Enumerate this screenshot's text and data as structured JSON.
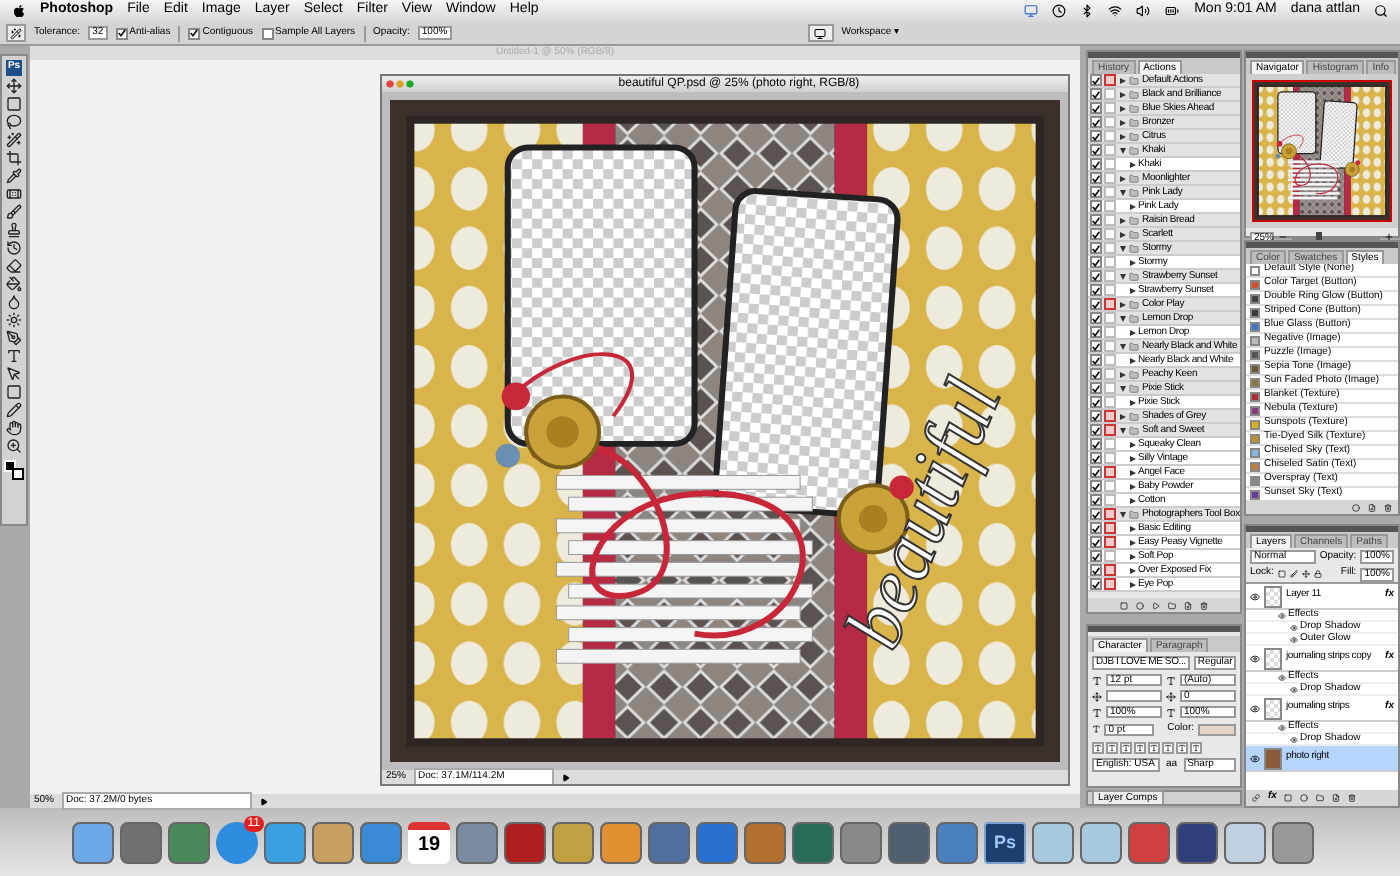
{
  "menu_bar": {
    "app": "Photoshop",
    "menus": [
      "File",
      "Edit",
      "Image",
      "Layer",
      "Select",
      "Filter",
      "View",
      "Window",
      "Help"
    ],
    "clock": "Mon 9:01 AM",
    "user": "dana attlan"
  },
  "options_bar": {
    "tolerance_label": "Tolerance:",
    "tolerance": "32",
    "anti_alias": {
      "label": "Anti-alias",
      "checked": true
    },
    "contiguous": {
      "label": "Contiguous",
      "checked": true
    },
    "sample_all_layers": {
      "label": "Sample All Layers",
      "checked": false
    },
    "opacity_label": "Opacity:",
    "opacity": "100%",
    "workspace": "Workspace ▾"
  },
  "background_window": {
    "title": "Untitled-1 @ 50% (RGB/8)",
    "zoom": "50%",
    "doc_info": "Doc: 37.2M/0 bytes"
  },
  "toolbox": {
    "logo": "Ps"
  },
  "document": {
    "title": "beautiful QP.psd @ 25% (photo right, RGB/8)",
    "word_art": "beautiful",
    "zoom": "25%",
    "doc_info": "Doc: 37.1M/114.2M"
  },
  "actions_panel": {
    "tabs": [
      {
        "label": "History",
        "selected": false
      },
      {
        "label": "Actions",
        "selected": true
      }
    ],
    "items": [
      {
        "name": "Default Actions",
        "checked": true,
        "dialog": true,
        "expanded": false
      },
      {
        "name": "Black and Brilliance",
        "checked": true,
        "dialog": false,
        "expanded": false
      },
      {
        "name": "Blue Skies Ahead",
        "checked": true,
        "dialog": false,
        "expanded": false
      },
      {
        "name": "Bronzer",
        "checked": true,
        "dialog": false,
        "expanded": false
      },
      {
        "name": "Citrus",
        "checked": true,
        "dialog": false,
        "expanded": false
      },
      {
        "name": "Khaki",
        "checked": true,
        "dialog": false,
        "expanded": true,
        "children": [
          {
            "name": "Khaki",
            "checked": true,
            "dialog": false
          }
        ]
      },
      {
        "name": "Moonlighter",
        "checked": true,
        "dialog": false,
        "expanded": false
      },
      {
        "name": "Pink Lady",
        "checked": true,
        "dialog": false,
        "expanded": true,
        "children": [
          {
            "name": "Pink Lady",
            "checked": true,
            "dialog": false
          }
        ]
      },
      {
        "name": "Raisin Bread",
        "checked": true,
        "dialog": false,
        "expanded": false
      },
      {
        "name": "Scarlett",
        "checked": true,
        "dialog": false,
        "expanded": false
      },
      {
        "name": "Stormy",
        "checked": true,
        "dialog": false,
        "expanded": true,
        "children": [
          {
            "name": "Stormy",
            "checked": true,
            "dialog": false
          }
        ]
      },
      {
        "name": "Strawberry Sunset",
        "checked": true,
        "dialog": false,
        "expanded": true,
        "children": [
          {
            "name": "Strawberry Sunset",
            "checked": true,
            "dialog": false
          }
        ]
      },
      {
        "name": "Color Play",
        "checked": true,
        "dialog": true,
        "expanded": false
      },
      {
        "name": "Lemon Drop",
        "checked": true,
        "dialog": false,
        "expanded": true,
        "children": [
          {
            "name": "Lemon Drop",
            "checked": true,
            "dialog": false
          }
        ]
      },
      {
        "name": "Nearly Black and White",
        "checked": true,
        "dialog": false,
        "expanded": true,
        "children": [
          {
            "name": "Nearly Black and White",
            "checked": true,
            "dialog": false
          }
        ]
      },
      {
        "name": "Peachy Keen",
        "checked": true,
        "dialog": false,
        "expanded": false
      },
      {
        "name": "Pixie Stick",
        "checked": true,
        "dialog": false,
        "expanded": true,
        "children": [
          {
            "name": "Pixie Stick",
            "checked": true,
            "dialog": false
          }
        ]
      },
      {
        "name": "Shades of Grey",
        "checked": true,
        "dialog": true,
        "expanded": false
      },
      {
        "name": "Soft and Sweet",
        "checked": true,
        "dialog": true,
        "expanded": true,
        "children": [
          {
            "name": "Squeaky Clean",
            "checked": true,
            "dialog": false
          },
          {
            "name": "Silly Vintage",
            "checked": true,
            "dialog": false
          },
          {
            "name": "Angel Face",
            "checked": true,
            "dialog": true
          },
          {
            "name": "Baby Powder",
            "checked": true,
            "dialog": false
          },
          {
            "name": "Cotton",
            "checked": true,
            "dialog": false
          }
        ]
      },
      {
        "name": "Photographers Tool Box",
        "checked": true,
        "dialog": true,
        "expanded": true,
        "children": [
          {
            "name": "Basic Editing",
            "checked": true,
            "dialog": true
          },
          {
            "name": "Easy Peasy Vignette",
            "checked": true,
            "dialog": true
          },
          {
            "name": "Soft Pop",
            "checked": true,
            "dialog": false
          },
          {
            "name": "Over Exposed Fix",
            "checked": true,
            "dialog": true
          },
          {
            "name": "Eye Pop",
            "checked": true,
            "dialog": true
          }
        ]
      }
    ]
  },
  "character_panel": {
    "tabs": [
      {
        "label": "Character",
        "selected": true
      },
      {
        "label": "Paragraph",
        "selected": false
      }
    ],
    "font": "DJB I LOVE ME SO...",
    "style": "Regular",
    "size": "12 pt",
    "leading": "(Auto)",
    "tracking": "0",
    "vertical_scale": "100%",
    "horizontal_scale": "100%",
    "baseline_shift": "0 pt",
    "color_label": "Color:",
    "language": "English: USA",
    "aa_label": "aa",
    "antialias": "Sharp"
  },
  "layer_comps_panel": {
    "title": "Layer Comps"
  },
  "navigator_panel": {
    "tabs": [
      {
        "label": "Navigator",
        "selected": true
      },
      {
        "label": "Histogram",
        "selected": false
      },
      {
        "label": "Info",
        "selected": false
      }
    ],
    "zoom": "25%",
    "zoom_slider": {
      "level": 0.3
    }
  },
  "styles_panel": {
    "tabs": [
      {
        "label": "Color",
        "selected": false
      },
      {
        "label": "Swatches",
        "selected": false
      },
      {
        "label": "Styles",
        "selected": true
      }
    ],
    "items": [
      {
        "name": "Default Style (None)",
        "color": "#ffffff"
      },
      {
        "name": "Color Target (Button)",
        "color": "#d0502a"
      },
      {
        "name": "Double Ring Glow (Button)",
        "color": "#444444"
      },
      {
        "name": "Striped Cone (Button)",
        "color": "#3a3a3a"
      },
      {
        "name": "Blue Glass (Button)",
        "color": "#3a78c8"
      },
      {
        "name": "Negative (Image)",
        "color": "#bbbbbb"
      },
      {
        "name": "Puzzle (Image)",
        "color": "#555555"
      },
      {
        "name": "Sepia Tone (Image)",
        "color": "#6b5a3a"
      },
      {
        "name": "Sun Faded Photo (Image)",
        "color": "#8a7440"
      },
      {
        "name": "Blanket (Texture)",
        "color": "#b03030"
      },
      {
        "name": "Nebula (Texture)",
        "color": "#8a3a80"
      },
      {
        "name": "Sunspots (Texture)",
        "color": "#d8b020"
      },
      {
        "name": "Tie-Dyed Silk (Texture)",
        "color": "#c09030"
      },
      {
        "name": "Chiseled Sky (Text)",
        "color": "#8ab8e0"
      },
      {
        "name": "Chiseled Satin (Text)",
        "color": "#c08040"
      },
      {
        "name": "Overspray (Text)",
        "color": "#888888"
      },
      {
        "name": "Sunset Sky (Text)",
        "color": "#6a3a9a"
      }
    ]
  },
  "layers_panel": {
    "tabs": [
      {
        "label": "Layers",
        "selected": true
      },
      {
        "label": "Channels",
        "selected": false
      },
      {
        "label": "Paths",
        "selected": false
      }
    ],
    "blend_mode": "Normal",
    "opacity_label": "Opacity:",
    "opacity": "100%",
    "lock_label": "Lock:",
    "fill_label": "Fill:",
    "fill": "100%",
    "footer_fx": "fx",
    "layers": [
      {
        "name": "Layer 11",
        "visible": true,
        "selected": false,
        "badge": "fx",
        "effects_label": "Effects",
        "effects": [
          "Drop Shadow",
          "Outer Glow"
        ]
      },
      {
        "name": "journaling strips copy",
        "visible": true,
        "selected": false,
        "badge": "fx",
        "effects_label": "Effects",
        "effects": [
          "Drop Shadow"
        ]
      },
      {
        "name": "journaling strips",
        "visible": true,
        "selected": false,
        "badge": "fx",
        "effects_label": "Effects",
        "effects": [
          "Drop Shadow"
        ]
      },
      {
        "name": "photo right",
        "visible": true,
        "selected": true
      }
    ]
  },
  "dock": {
    "badge": "11",
    "calendar_day": "19",
    "ps_label": "Ps"
  }
}
